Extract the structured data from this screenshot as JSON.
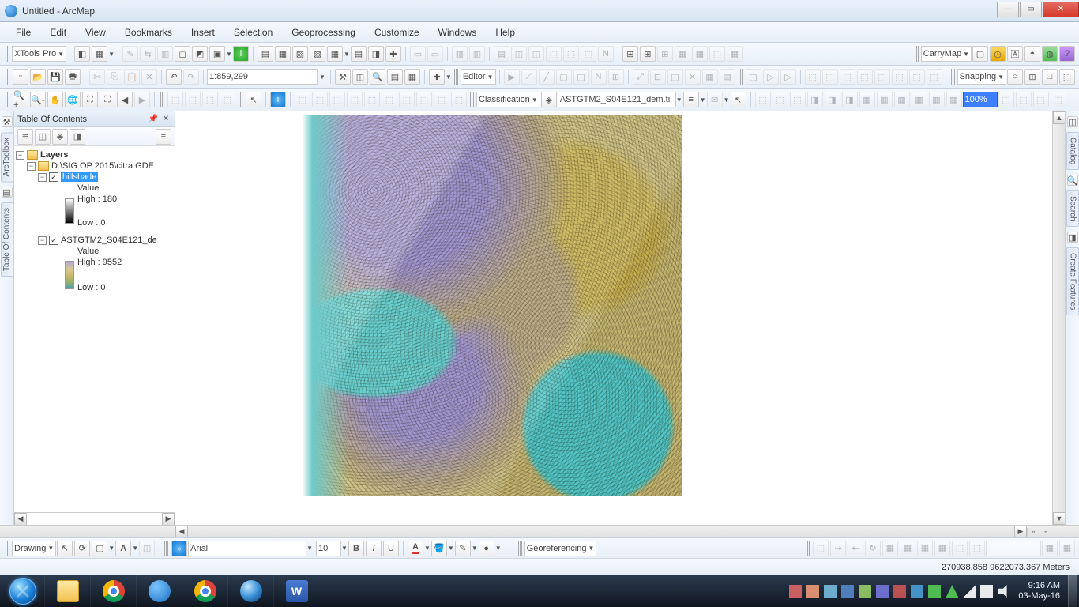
{
  "title": "Untitled - ArcMap",
  "menus": [
    "File",
    "Edit",
    "View",
    "Bookmarks",
    "Insert",
    "Selection",
    "Geoprocessing",
    "Customize",
    "Windows",
    "Help"
  ],
  "xtools_label": "XTools Pro",
  "carrymap_label": "CarryMap",
  "scale_value": "1:859,299",
  "editor_label": "Editor",
  "classification_label": "Classification",
  "classification_layer": "ASTGTM2_S04E121_dem.ti",
  "snapping_label": "Snapping",
  "table_cell": "100%",
  "left_tabs": [
    "ArcToolbox",
    "Table Of Contents"
  ],
  "right_tabs": [
    "Catalog",
    "Search",
    "Create Features"
  ],
  "toc": {
    "title": "Table Of Contents",
    "layers_label": "Layers",
    "datasource": "D:\\SIG OP 2015\\citra GDE",
    "layer1": {
      "name": "hillshade",
      "value_label": "Value",
      "high": "High : 180",
      "low": "Low : 0"
    },
    "layer2": {
      "name": "ASTGTM2_S04E121_de",
      "value_label": "Value",
      "high": "High : 9552",
      "low": "Low : 0"
    }
  },
  "drawing_label": "Drawing",
  "font_name": "Arial",
  "font_size": "10",
  "georef_label": "Georeferencing",
  "status_coords": "270938.858  9622073.367 Meters",
  "taskbar": {
    "time": "9:16 AM",
    "date": "03-May-16"
  }
}
